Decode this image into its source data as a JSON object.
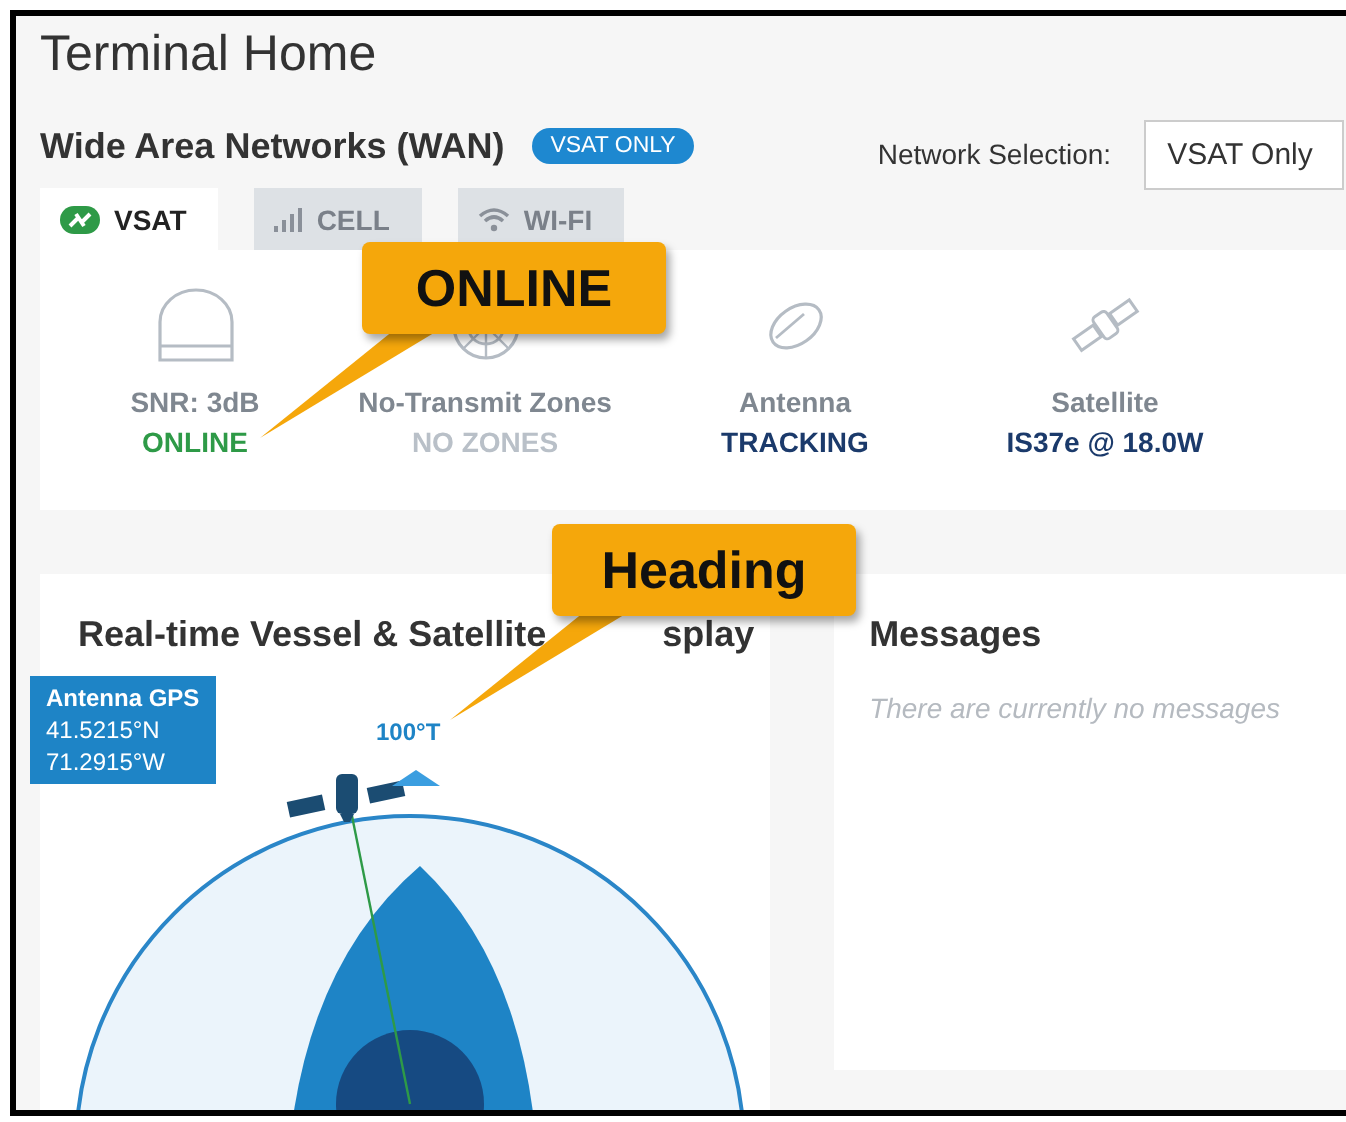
{
  "page_title": "Terminal Home",
  "wan": {
    "title": "Wide Area Networks (WAN)",
    "badge": "VSAT ONLY",
    "network_selection": {
      "label": "Network Selection:",
      "value": "VSAT Only"
    }
  },
  "tabs": [
    {
      "label": "VSAT",
      "kind": "vsat",
      "selected": true
    },
    {
      "label": "CELL",
      "kind": "cell",
      "selected": false
    },
    {
      "label": "WI-FI",
      "kind": "wifi",
      "selected": false
    }
  ],
  "status_items": [
    {
      "kind": "dome",
      "label": "SNR: 3dB",
      "value": "ONLINE",
      "color": "#2e9a47"
    },
    {
      "kind": "zones",
      "label": "No-Transmit Zones",
      "value": "NO ZONES",
      "color": "#b9c0c8"
    },
    {
      "kind": "dish",
      "label": "Antenna",
      "value": "TRACKING",
      "color": "#1b3a6b"
    },
    {
      "kind": "satellite",
      "label": "Satellite",
      "value": "IS37e @ 18.0W",
      "color": "#1b3a6b"
    }
  ],
  "display": {
    "title_start": "Real-time Vessel & Satellite",
    "title_end": "splay",
    "gps": {
      "title": "Antenna GPS",
      "lat": "41.5215°N",
      "lon": "71.2915°W"
    },
    "heading": "100°T"
  },
  "messages": {
    "title": "Messages",
    "empty_text": "There are currently no messages"
  },
  "callouts": [
    {
      "text": "ONLINE"
    },
    {
      "text": "Heading"
    }
  ]
}
